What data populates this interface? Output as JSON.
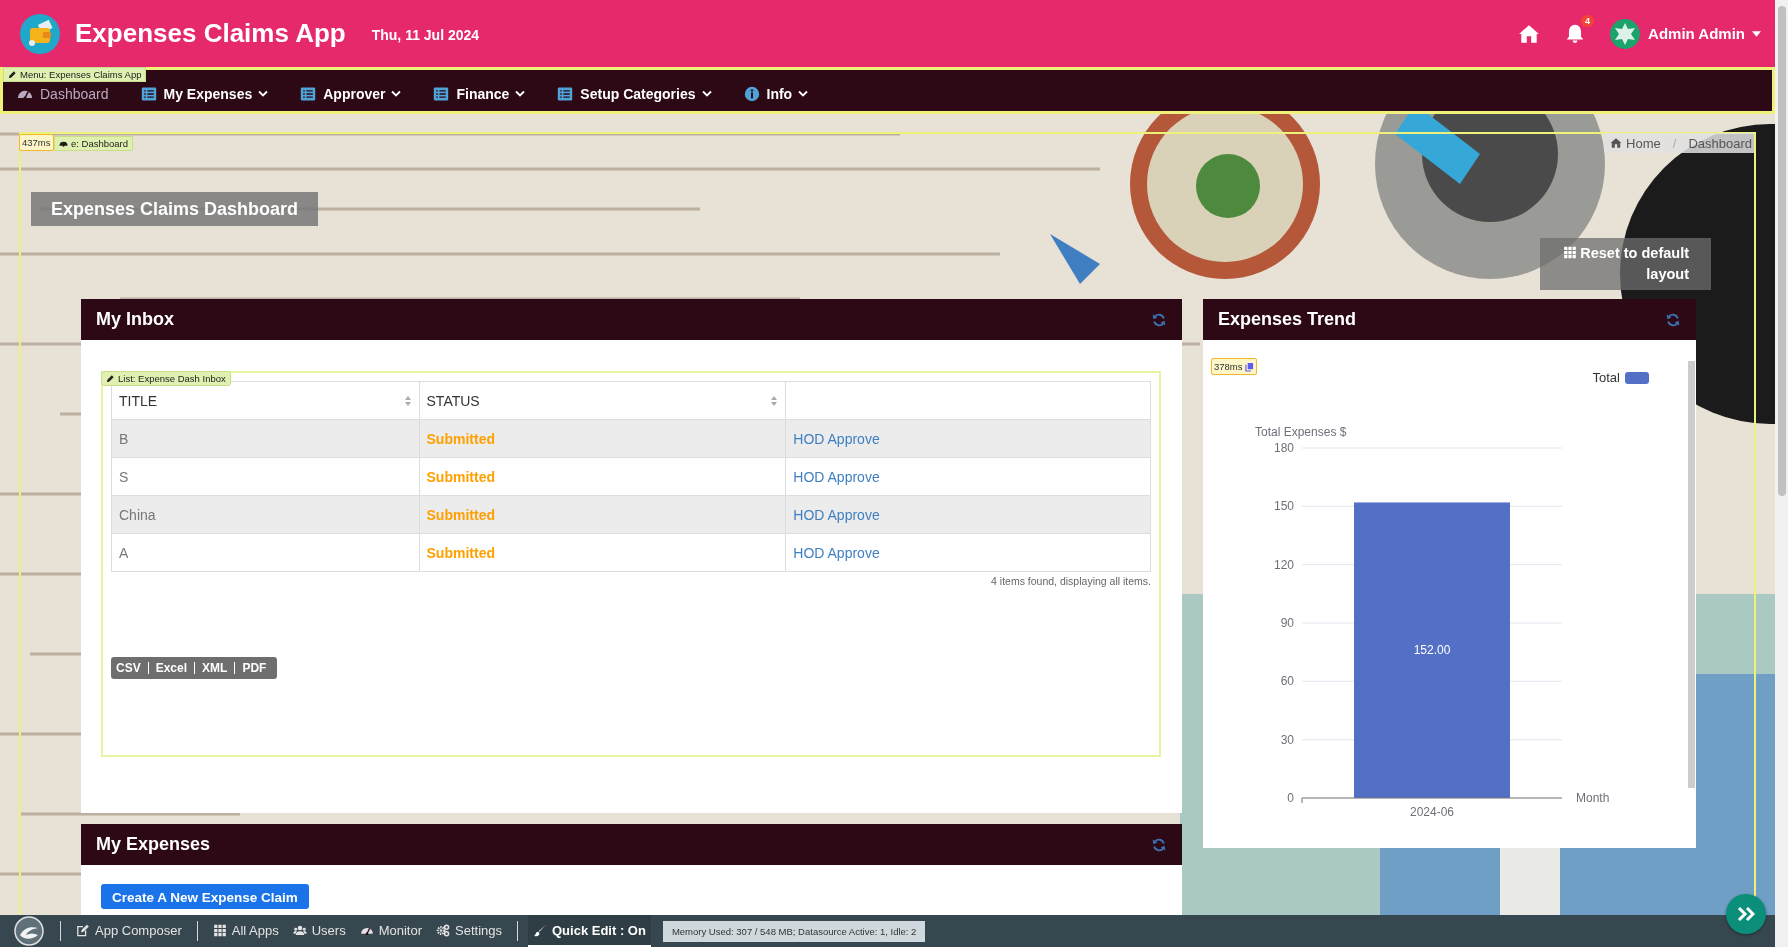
{
  "app": {
    "title": "Expenses Claims App",
    "date": "Thu, 11 Jul 2024",
    "notifications": "4",
    "user": "Admin Admin"
  },
  "menu": {
    "tag": "Menu: Expenses Claims App",
    "items": [
      {
        "label": "Dashboard",
        "kind": "gauge",
        "selected": true,
        "dropdown": false
      },
      {
        "label": "My Expenses",
        "kind": "list",
        "selected": false,
        "dropdown": true
      },
      {
        "label": "Approver",
        "kind": "list",
        "selected": false,
        "dropdown": true
      },
      {
        "label": "Finance",
        "kind": "list",
        "selected": false,
        "dropdown": true
      },
      {
        "label": "Setup Categories",
        "kind": "list",
        "selected": false,
        "dropdown": true
      },
      {
        "label": "Info",
        "kind": "info",
        "selected": false,
        "dropdown": true
      }
    ]
  },
  "page": {
    "timing": "437ms",
    "tag": "e: Dashboard",
    "breadcrumbs": [
      {
        "label": "Home",
        "kind": "home"
      },
      {
        "label": "Dashboard",
        "kind": "text"
      }
    ],
    "breadcrumb_separator": "/",
    "title": "Expenses Claims Dashboard",
    "reset_button": "Reset to default layout"
  },
  "inbox": {
    "title": "My Inbox",
    "list_tag": "List: Expense Dash Inbox",
    "columns": [
      {
        "label": "TITLE",
        "sortable": true
      },
      {
        "label": "STATUS",
        "sortable": true
      }
    ],
    "rows": [
      {
        "title": "B",
        "status": "Submitted",
        "action": "HOD Approve"
      },
      {
        "title": "S",
        "status": "Submitted",
        "action": "HOD Approve"
      },
      {
        "title": "China",
        "status": "Submitted",
        "action": "HOD Approve"
      },
      {
        "title": "A",
        "status": "Submitted",
        "action": "HOD Approve"
      }
    ],
    "summary": "4 items found, displaying all items.",
    "exports": [
      "CSV",
      "Excel",
      "XML",
      "PDF"
    ]
  },
  "trend": {
    "title": "Expenses Trend",
    "timing": "378ms",
    "chart_data": {
      "type": "bar",
      "ylabel": "Total Expenses $",
      "xlabel": "Month",
      "categories": [
        "2024-06"
      ],
      "series": [
        {
          "name": "Total",
          "color": "#5470c6",
          "values": [
            152
          ]
        }
      ],
      "ylim": [
        0,
        180
      ],
      "yticks": [
        0,
        30,
        60,
        90,
        120,
        150,
        180
      ],
      "grid": true,
      "value_labels": [
        "152.00"
      ]
    }
  },
  "my_expenses": {
    "title": "My Expenses",
    "button": "Create A New Expense Claim"
  },
  "toolbar": {
    "items": [
      {
        "label": "App Composer",
        "kind": "edit",
        "selected": false,
        "divider_before": true
      },
      {
        "label": "All Apps",
        "kind": "grid",
        "selected": false,
        "divider_before": true
      },
      {
        "label": "Users",
        "kind": "users",
        "selected": false,
        "divider_before": false
      },
      {
        "label": "Monitor",
        "kind": "gauge",
        "selected": false,
        "divider_before": false
      },
      {
        "label": "Settings",
        "kind": "gears",
        "selected": false,
        "divider_before": false
      },
      {
        "label": "Quick Edit : On",
        "kind": "brush",
        "selected": true,
        "divider_before": true
      }
    ],
    "memory": "Memory Used: 307 / 548 MB; Datasource Active: 1, Idle: 2"
  }
}
